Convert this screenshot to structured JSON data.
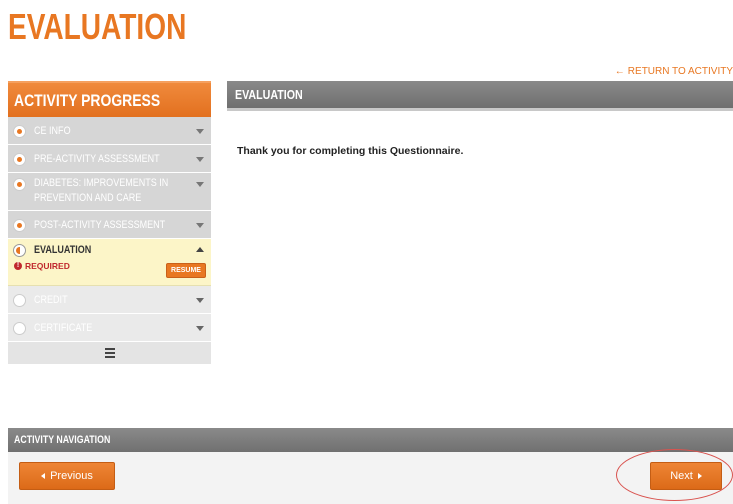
{
  "page": {
    "title": "EVALUATION"
  },
  "return_link": {
    "label": "RETURN TO ACTIVITY",
    "icon": "arrow-left-icon"
  },
  "sidebar": {
    "title": "ACTIVITY PROGRESS",
    "items": [
      {
        "label": "CE INFO",
        "state": "complete"
      },
      {
        "label": "PRE-ACTIVITY ASSESSMENT",
        "state": "complete"
      },
      {
        "label_line1": "DIABETES: IMPROVEMENTS IN",
        "label_line2": "PREVENTION AND CARE",
        "state": "complete"
      },
      {
        "label": "POST-ACTIVITY ASSESSMENT",
        "state": "complete"
      },
      {
        "label": "EVALUATION",
        "state": "in-progress",
        "status": "REQUIRED",
        "action": "RESUME"
      },
      {
        "label": "CREDIT",
        "state": "locked"
      },
      {
        "label": "CERTIFICATE",
        "state": "locked"
      }
    ],
    "footer_icon": "hamburger-menu-icon"
  },
  "main": {
    "header": "EVALUATION",
    "message": "Thank you for completing this Questionnaire."
  },
  "navigation": {
    "title": "ACTIVITY NAVIGATION",
    "previous_label": "Previous",
    "next_label": "Next"
  },
  "colors": {
    "accent": "#e87722",
    "header_gray": "#7a7a7a",
    "current_bg": "#fcf5c8",
    "required": "#c0282d",
    "highlight": "#d9534f"
  }
}
